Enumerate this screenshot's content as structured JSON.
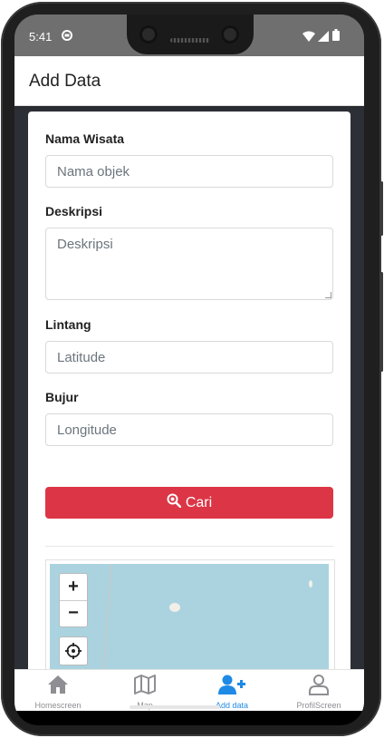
{
  "status": {
    "time": "5:41"
  },
  "appbar": {
    "title": "Add Data"
  },
  "form": {
    "name_label": "Nama Wisata",
    "name_placeholder": "Nama objek",
    "desc_label": "Deskripsi",
    "desc_placeholder": "Deskripsi",
    "lat_label": "Lintang",
    "lat_placeholder": "Latitude",
    "lng_label": "Bujur",
    "lng_placeholder": "Longitude",
    "search_button": "Cari"
  },
  "map": {
    "zoom_in": "+",
    "zoom_out": "−"
  },
  "nav": {
    "items": [
      {
        "label": "Homescreen",
        "icon": "home-icon",
        "active": false
      },
      {
        "label": "Map",
        "icon": "map-icon",
        "active": false
      },
      {
        "label": "Add data",
        "icon": "add-user-icon",
        "active": true
      },
      {
        "label": "ProfilScreen",
        "icon": "user-icon",
        "active": false
      }
    ]
  },
  "colors": {
    "accent": "#1e8ae6",
    "danger": "#dc3545",
    "map_water": "#aad3df"
  }
}
